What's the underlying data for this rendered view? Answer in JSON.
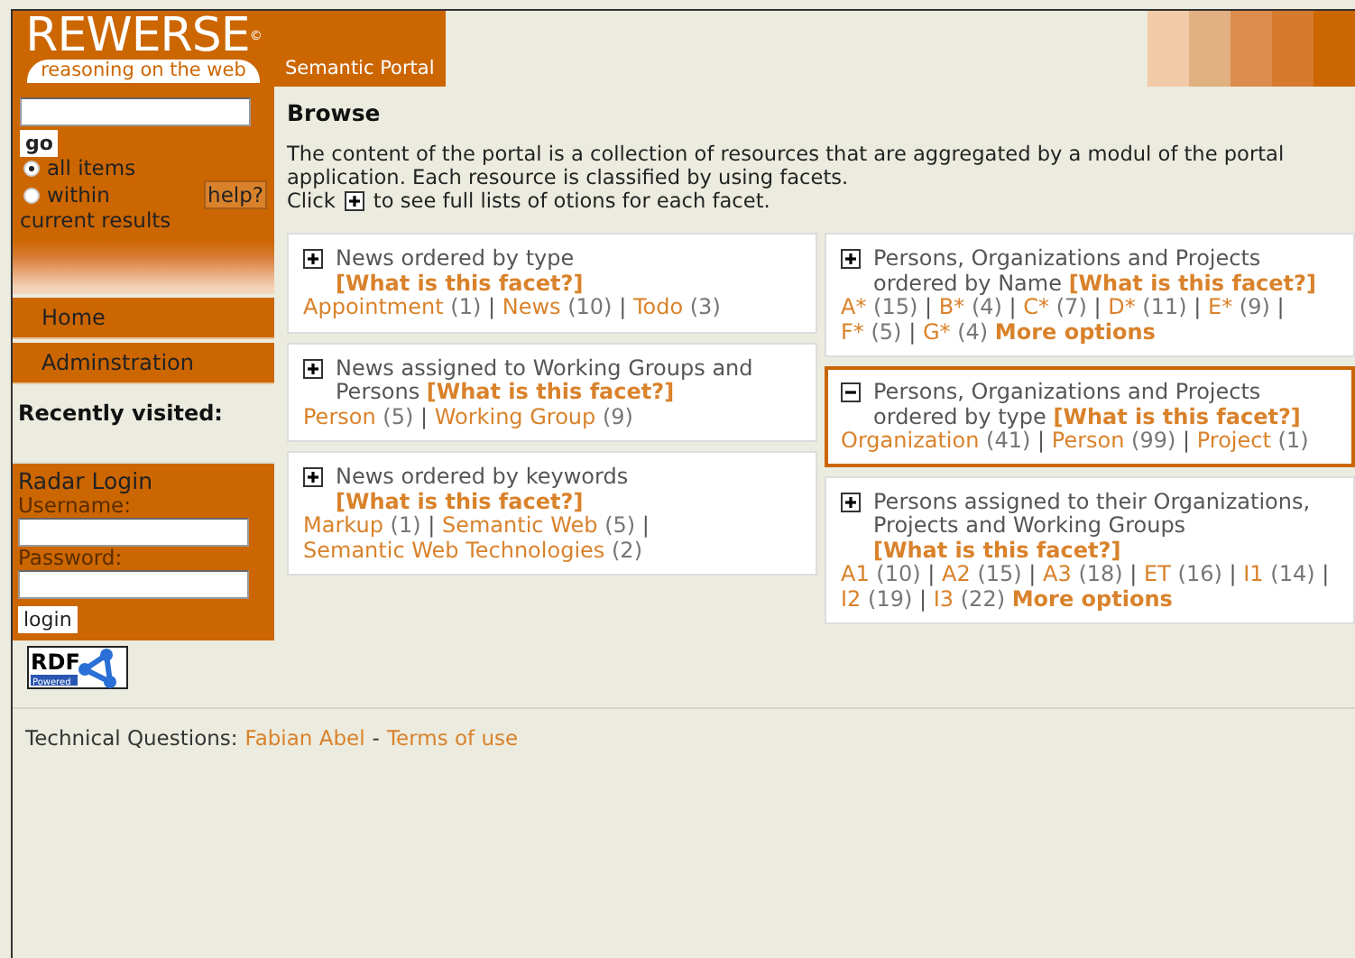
{
  "logo": {
    "name": "REWERSE",
    "mark": "©",
    "tagline": "reasoning on the web"
  },
  "header": {
    "tab": "Semantic Portal"
  },
  "search": {
    "go": "go",
    "scopes": [
      {
        "label": "all items",
        "selected": true
      },
      {
        "label": "within",
        "selected": false
      }
    ],
    "scope_note": "current results",
    "help": "help?"
  },
  "nav": [
    {
      "label": "Home"
    },
    {
      "label": "Adminstration"
    }
  ],
  "recently_visited": "Recently visited:",
  "login": {
    "title": "Radar Login",
    "username_label": "Username:",
    "password_label": "Password:",
    "button": "login"
  },
  "rdf_badge": {
    "text": "RDF",
    "subtext": "Powered"
  },
  "browse": {
    "title": "Browse",
    "intro": "The content of the portal is a collection of resources that are aggregated by a modul of the portal application. Each resource is classified by using facets.",
    "click_before": "Click",
    "click_after": "to see full lists of otions for each facet.",
    "columns": [
      [
        {
          "title": "News ordered by type",
          "expanded": false,
          "help": "[What is this facet?]",
          "options": [
            {
              "label": "Appointment",
              "count": "(1)"
            },
            {
              "sep": "|",
              "label": "News",
              "count": "(10)"
            },
            {
              "sep": "|",
              "label": "Todo",
              "count": "(3)"
            }
          ]
        },
        {
          "title": "News assigned to Working Groups and Persons",
          "expanded": false,
          "help": "[What is this facet?]",
          "options": [
            {
              "label": "Person",
              "count": "(5)"
            },
            {
              "sep": "|",
              "label": "Working Group",
              "count": "(9)"
            }
          ]
        },
        {
          "title": "News ordered by keywords",
          "expanded": false,
          "help": "[What is this facet?]",
          "options": [
            {
              "label": "Markup",
              "count": "(1)"
            },
            {
              "sep": "|",
              "label": "Semantic Web",
              "count": "(5)"
            },
            {
              "sep": "|",
              "label": "Semantic Web Technologies",
              "count": "(2)"
            }
          ]
        }
      ],
      [
        {
          "title": "Persons, Organizations and Projects ordered by Name",
          "expanded": false,
          "help": "[What is this facet?]",
          "options": [
            {
              "label": "A*",
              "count": "(15)"
            },
            {
              "sep": "|",
              "label": "B*",
              "count": "(4)"
            },
            {
              "sep": "|",
              "label": "C*",
              "count": "(7)"
            },
            {
              "sep": "|",
              "label": "D*",
              "count": "(11)"
            },
            {
              "sep": "|",
              "label": "E*",
              "count": "(9)"
            },
            {
              "sep": "|",
              "label": "F*",
              "count": "(5)"
            },
            {
              "sep": "|",
              "label": "G*",
              "count": "(4)"
            }
          ],
          "more": "More options"
        },
        {
          "title": "Persons, Organizations and Projects ordered by type",
          "expanded": true,
          "help": "[What is this facet?]",
          "options": [
            {
              "label": "Organization",
              "count": "(41)"
            },
            {
              "sep": "|",
              "label": "Person",
              "count": "(99)"
            },
            {
              "sep": "|",
              "label": "Project",
              "count": "(1)"
            }
          ]
        },
        {
          "title": "Persons assigned to their Organizations, Projects and Working Groups",
          "expanded": false,
          "help": "[What is this facet?]",
          "options": [
            {
              "label": "A1",
              "count": "(10)"
            },
            {
              "sep": "|",
              "label": "A2",
              "count": "(15)"
            },
            {
              "sep": "|",
              "label": "A3",
              "count": "(18)"
            },
            {
              "sep": "|",
              "label": "ET",
              "count": "(16)"
            },
            {
              "sep": "|",
              "label": "I1",
              "count": "(14)"
            },
            {
              "sep": "|",
              "label": "I2",
              "count": "(19)"
            },
            {
              "sep": "|",
              "label": "I3",
              "count": "(22)"
            }
          ],
          "more": "More options"
        }
      ]
    ]
  },
  "footer": {
    "label": "Technical Questions:",
    "contact": "Fabian Abel",
    "sep": "-",
    "terms": "Terms of use"
  }
}
